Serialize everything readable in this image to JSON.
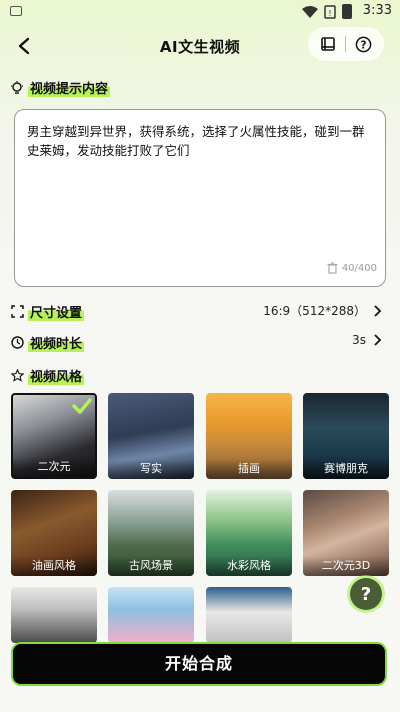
{
  "status_bar": {
    "time": "3:33",
    "icons": [
      "keyboard-icon",
      "wifi-icon",
      "notification-icon",
      "battery-icon"
    ]
  },
  "header": {
    "title": "AI文生视频",
    "actions": [
      "book-icon",
      "help-icon"
    ]
  },
  "prompt_section": {
    "label": "视频提示内容",
    "text": "男主穿越到异世界，获得系统，选择了火属性技能，碰到一群史莱姆，发动技能打败了它们",
    "counter": "40/400"
  },
  "size_setting": {
    "label": "尺寸设置",
    "value": "16:9（512*288）"
  },
  "duration_setting": {
    "label": "视频时长",
    "value": "3s"
  },
  "style_section": {
    "label": "视频风格",
    "styles": [
      {
        "label": "二次元",
        "selected": true
      },
      {
        "label": "写实",
        "selected": false
      },
      {
        "label": "插画",
        "selected": false
      },
      {
        "label": "赛博朋克",
        "selected": false
      },
      {
        "label": "油画风格",
        "selected": false
      },
      {
        "label": "古风场景",
        "selected": false
      },
      {
        "label": "水彩风格",
        "selected": false
      },
      {
        "label": "二次元3D",
        "selected": false
      },
      {
        "label": "",
        "selected": false
      },
      {
        "label": "",
        "selected": false
      },
      {
        "label": "",
        "selected": false
      }
    ]
  },
  "fab": {
    "label": "?"
  },
  "start_button": {
    "label": "开始合成"
  },
  "colors": {
    "accent": "#b8f05a",
    "button_bg": "#050505",
    "button_border": "#7fdc3a"
  }
}
